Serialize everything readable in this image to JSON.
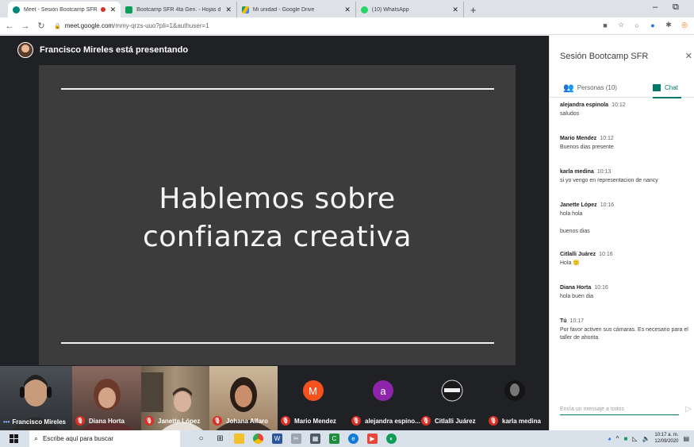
{
  "browser": {
    "tabs": [
      {
        "label": "Meet - Sesión Bootcamp SFR",
        "favicon_color": "#00897b",
        "active": true,
        "recording": true
      },
      {
        "label": "Bootcamp SFR 4ta Gen. - Hojas d",
        "favicon_color": "#0f9d58",
        "active": false
      },
      {
        "label": "Mi unidad - Google Drive",
        "favicon_color": "#fbbc04",
        "active": false
      },
      {
        "label": "(10) WhatsApp",
        "favicon_color": "#25d366",
        "active": false
      }
    ],
    "url_host": "meet.google.com",
    "url_path": "/mmy-qrzs-uuo?pli=1&authuser=1"
  },
  "meet": {
    "presenter_label": "Francisco Mireles está presentando",
    "slide_title_line1": "Hablemos sobre",
    "slide_title_line2": "confianza creativa",
    "participants": [
      {
        "name": "Francisco Mireles",
        "type": "video",
        "muted": false,
        "bg": "#3a3f45"
      },
      {
        "name": "Diana Horta",
        "type": "video",
        "muted": true,
        "bg": "#6b4f4a"
      },
      {
        "name": "Janette López",
        "type": "video",
        "muted": true,
        "bg": "#7a6a55"
      },
      {
        "name": "Johana Alfaro",
        "type": "video",
        "muted": true,
        "bg": "#b89a7a"
      },
      {
        "name": "Mario Mendez",
        "type": "letter",
        "letter": "M",
        "color": "#f4511e",
        "muted": true
      },
      {
        "name": "alejandra espino...",
        "type": "letter",
        "letter": "a",
        "color": "#8e24aa",
        "muted": true
      },
      {
        "name": "Citlalli Juárez",
        "type": "logo",
        "muted": true
      },
      {
        "name": "karla medina",
        "type": "photo",
        "muted": true
      }
    ]
  },
  "sidebar": {
    "title": "Sesión Bootcamp SFR",
    "people_tab": "Personas (10)",
    "chat_tab": "Chat",
    "messages": [
      {
        "author": "alejandra espinola",
        "time": "10:12",
        "lines": [
          "saludos"
        ]
      },
      {
        "author": "Mario Mendez",
        "time": "10:12",
        "lines": [
          "Buenos dias presente"
        ]
      },
      {
        "author": "karla medina",
        "time": "10:13",
        "lines": [
          "si yo vengo en representacion de nancy"
        ]
      },
      {
        "author": "Janette López",
        "time": "10:16",
        "lines": [
          "hola hola",
          "buenos dias"
        ]
      },
      {
        "author": "Citlalli Juárez",
        "time": "10:16",
        "lines": [
          "Hola 🙂"
        ]
      },
      {
        "author": "Diana Horta",
        "time": "10:16",
        "lines": [
          "hola buen dia"
        ]
      },
      {
        "author": "Tú",
        "time": "10:17",
        "lines": [
          "Por favor activen sus cámaras. Es necesario para el taller de ahorita"
        ]
      }
    ],
    "compose_placeholder": "Envía un mensaje a todos"
  },
  "taskbar": {
    "search_placeholder": "Escribe aquí para buscar",
    "time": "10:17 a. m.",
    "date": "12/09/2020"
  }
}
